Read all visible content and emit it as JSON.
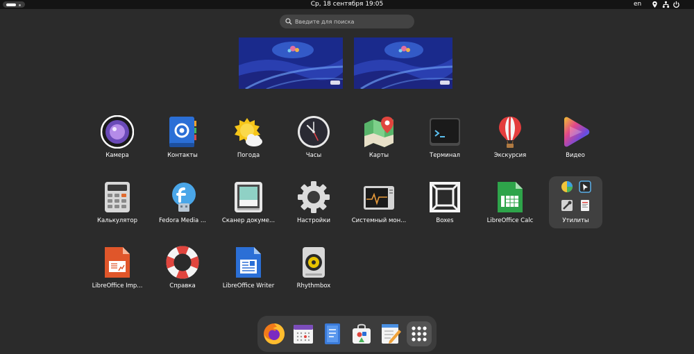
{
  "topbar": {
    "datetime": "Ср, 18 сентября  19:05",
    "lang": "en",
    "tray_icons": [
      "location-icon",
      "network-icon",
      "power-icon"
    ]
  },
  "search": {
    "placeholder": "Введите для поиска"
  },
  "workspaces": 2,
  "apps": [
    {
      "label": "Камера",
      "icon": "camera-icon"
    },
    {
      "label": "Контакты",
      "icon": "contacts-icon"
    },
    {
      "label": "Погода",
      "icon": "weather-icon"
    },
    {
      "label": "Часы",
      "icon": "clock-icon"
    },
    {
      "label": "Карты",
      "icon": "maps-icon"
    },
    {
      "label": "Терминал",
      "icon": "terminal-icon"
    },
    {
      "label": "Экскурсия",
      "icon": "tour-icon"
    },
    {
      "label": "Видео",
      "icon": "video-icon"
    },
    {
      "label": "Калькулятор",
      "icon": "calculator-icon"
    },
    {
      "label": "Fedora Media ...",
      "icon": "fedora-media-writer-icon"
    },
    {
      "label": "Сканер докуме...",
      "icon": "document-scanner-icon"
    },
    {
      "label": "Настройки",
      "icon": "settings-icon"
    },
    {
      "label": "Системный мон...",
      "icon": "system-monitor-icon"
    },
    {
      "label": "Boxes",
      "icon": "boxes-icon"
    },
    {
      "label": "LibreOffice Calc",
      "icon": "libreoffice-calc-icon"
    },
    {
      "label": "Утилиты",
      "icon": "utilities-folder-icon"
    },
    {
      "label": "LibreOffice Imp...",
      "icon": "libreoffice-impress-icon"
    },
    {
      "label": "Справка",
      "icon": "help-icon"
    },
    {
      "label": "LibreOffice Writer",
      "icon": "libreoffice-writer-icon"
    },
    {
      "label": "Rhythmbox",
      "icon": "rhythmbox-icon"
    }
  ],
  "dock": [
    "firefox-icon",
    "calendar-icon",
    "text-editor-icon",
    "software-icon",
    "notes-icon",
    "show-apps-icon"
  ],
  "colors": {
    "background": "#2b2b2b",
    "topbar": "#141414",
    "dock": "#3c3c3c",
    "folder": "#404040"
  }
}
